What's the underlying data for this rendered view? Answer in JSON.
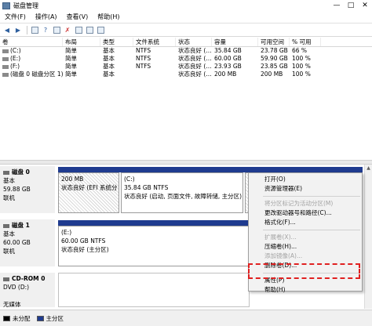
{
  "window": {
    "title": "磁盘管理"
  },
  "menu": [
    "文件(F)",
    "操作(A)",
    "查看(V)",
    "帮助(H)"
  ],
  "table": {
    "headers": [
      "卷",
      "布局",
      "类型",
      "文件系统",
      "状态",
      "容量",
      "可用空间",
      "% 可用"
    ],
    "rows": [
      [
        "(C:)",
        "简单",
        "基本",
        "NTFS",
        "状态良好 (...",
        "35.84 GB",
        "23.78 GB",
        "66 %"
      ],
      [
        "(E:)",
        "简单",
        "基本",
        "NTFS",
        "状态良好 (...",
        "60.00 GB",
        "59.90 GB",
        "100 %"
      ],
      [
        "(F:)",
        "简单",
        "基本",
        "NTFS",
        "状态良好 (...",
        "23.93 GB",
        "23.85 GB",
        "100 %"
      ],
      [
        "(磁盘 0 磁盘分区 1)",
        "简单",
        "基本",
        "",
        "状态良好 (...",
        "200 MB",
        "200 MB",
        "100 %"
      ]
    ]
  },
  "disks": [
    {
      "name": "磁盘 0",
      "type": "基本",
      "size": "59.88 GB",
      "status": "联机",
      "partitions": [
        {
          "line1": "200 MB",
          "line2": "状态良好 (EFI 系统分"
        },
        {
          "line1": "(C:)",
          "line2": "35.84 GB NTFS",
          "line3": "状态良好 (启动, 页面文件, 故障转储, 主分区)"
        },
        {
          "line1": "",
          "line2": ""
        }
      ]
    },
    {
      "name": "磁盘 1",
      "type": "基本",
      "size": "60.00 GB",
      "status": "联机",
      "partitions": [
        {
          "line1": "(E:)",
          "line2": "60.00 GB NTFS",
          "line3": "状态良好 (主分区)"
        }
      ]
    },
    {
      "name": "CD-ROM 0",
      "type": "DVD (D:)",
      "size": "",
      "status": "无媒体"
    }
  ],
  "context_menu": {
    "items": [
      {
        "label": "打开(O)",
        "disabled": false
      },
      {
        "label": "资源管理器(E)",
        "disabled": false
      },
      {
        "sep": true
      },
      {
        "label": "将分区标记为活动分区(M)",
        "disabled": true
      },
      {
        "label": "更改驱动器号和路径(C)...",
        "disabled": false
      },
      {
        "label": "格式化(F)...",
        "disabled": false
      },
      {
        "sep": true
      },
      {
        "label": "扩展卷(X)...",
        "disabled": true
      },
      {
        "label": "压缩卷(H)...",
        "disabled": false
      },
      {
        "label": "添加镜像(A)...",
        "disabled": true
      },
      {
        "label": "删除卷(D)...",
        "disabled": false
      },
      {
        "sep": true
      },
      {
        "label": "属性(P)",
        "disabled": false
      },
      {
        "label": "帮助(H)",
        "disabled": false
      }
    ]
  },
  "legend": [
    {
      "label": "未分配",
      "color": "#000000"
    },
    {
      "label": "主分区",
      "color": "#1f3b8f"
    }
  ],
  "colors": {
    "partition_bar": "#1f3b8f",
    "highlight": "#e02020"
  }
}
